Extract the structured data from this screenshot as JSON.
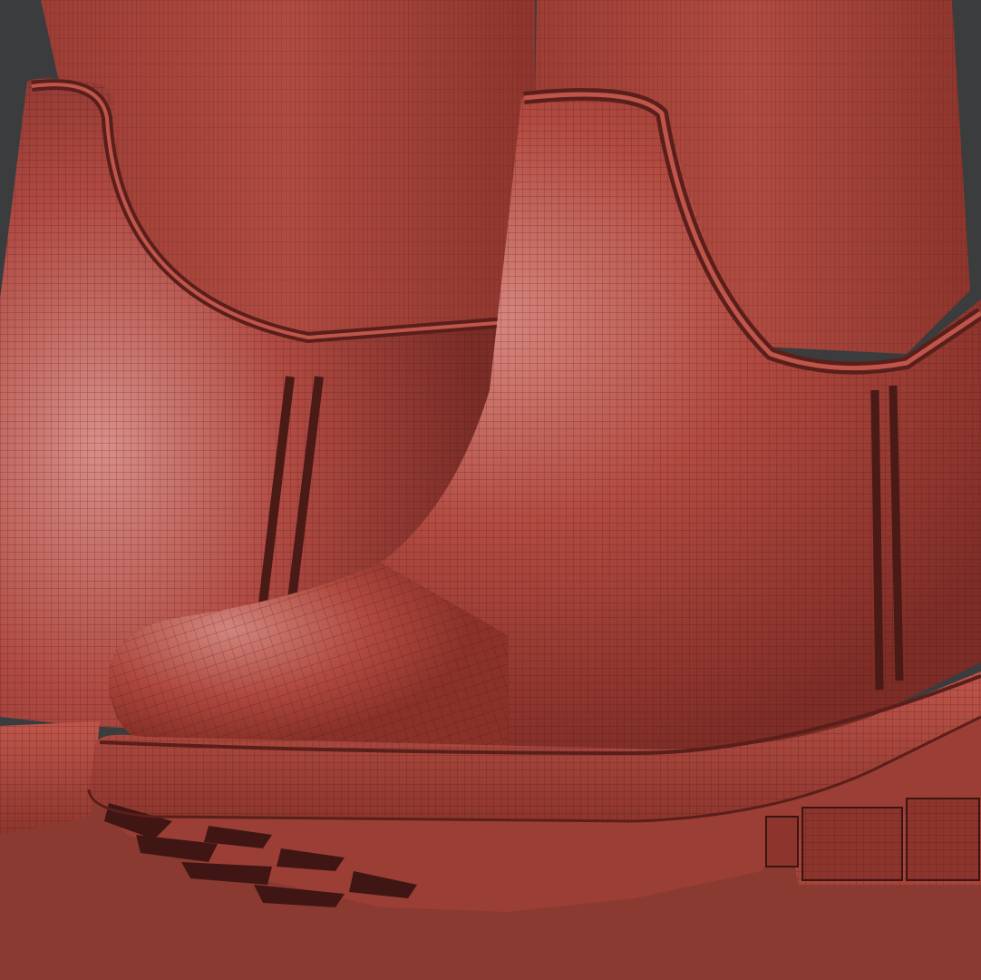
{
  "viewport": {
    "background": "#3b3c3d",
    "floor_color": "#8a3a30"
  },
  "model": {
    "base_color": "#b24a40",
    "highlight_color": "#e39a93",
    "shadow_color": "#5a1f1b",
    "wire_color": "#3a1512",
    "sole_tread_color": "#3f1614"
  }
}
